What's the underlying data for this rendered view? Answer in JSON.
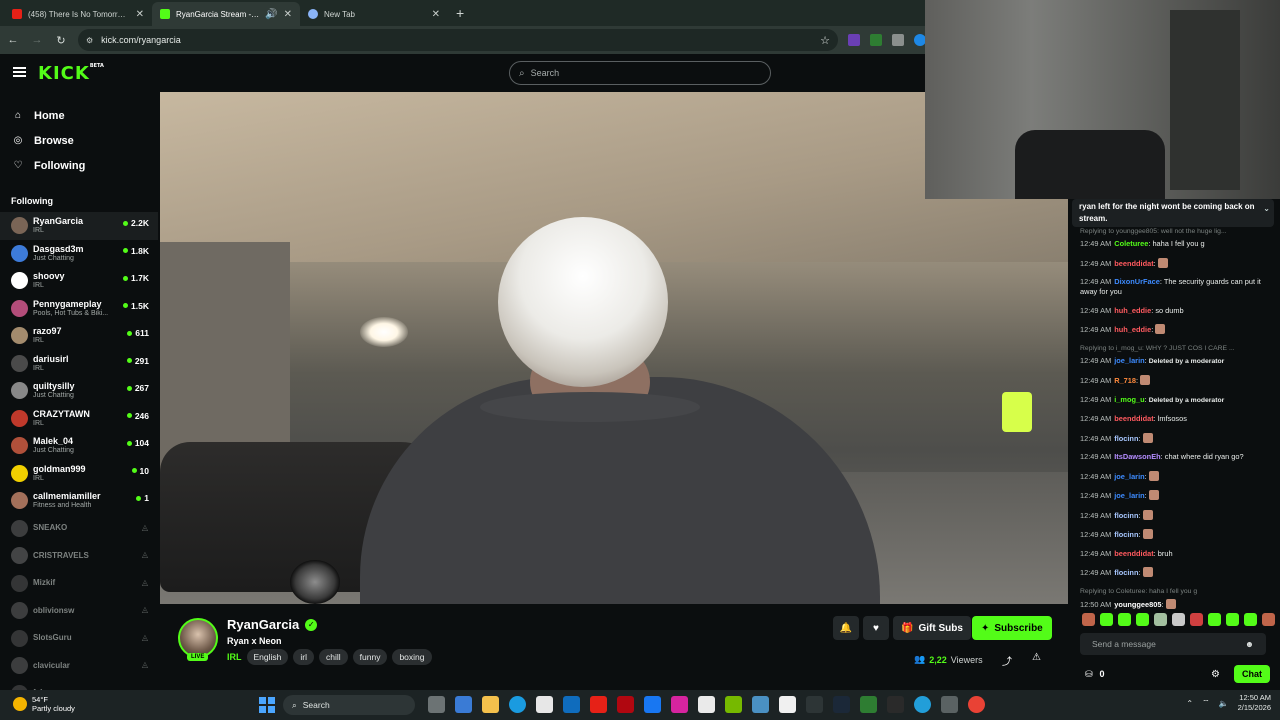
{
  "browser": {
    "tabs": [
      {
        "title": "(458) There Is No Tomorrow - Y",
        "favicon_color": "#e62117",
        "active": false
      },
      {
        "title": "RyanGarcia Stream - Watch",
        "favicon_color": "#53fc18",
        "active": true
      },
      {
        "title": "New Tab",
        "favicon_color": "#8ab4f8",
        "active": false
      }
    ],
    "url": "kick.com/ryangarcia"
  },
  "header": {
    "logo": "KICK",
    "logo_badge": "BETA",
    "search_placeholder": "Search"
  },
  "sidebar": {
    "nav": [
      {
        "label": "Home",
        "icon": "home-icon"
      },
      {
        "label": "Browse",
        "icon": "compass-icon"
      },
      {
        "label": "Following",
        "icon": "heart-icon"
      }
    ],
    "following_title": "Following",
    "channels": [
      {
        "name": "RyanGarcia",
        "category": "IRL",
        "viewers": "2.2K",
        "color": "#7a6556"
      },
      {
        "name": "Dasgasd3m",
        "category": "Just Chatting",
        "viewers": "1.8K",
        "color": "#3d7bd9"
      },
      {
        "name": "shoovy",
        "category": "IRL",
        "viewers": "1.7K",
        "color": "#ffffff"
      },
      {
        "name": "Pennygameplay",
        "category": "Pools, Hot Tubs & Biki...",
        "viewers": "1.5K",
        "color": "#b34d7a"
      },
      {
        "name": "razo97",
        "category": "IRL",
        "viewers": "611",
        "color": "#a38b6d"
      },
      {
        "name": "dariusirl",
        "category": "IRL",
        "viewers": "291",
        "color": "#4a4a4a"
      },
      {
        "name": "quiltysilly",
        "category": "Just Chatting",
        "viewers": "267",
        "color": "#888"
      },
      {
        "name": "CRAZYTAWN",
        "category": "IRL",
        "viewers": "246",
        "color": "#c0392b"
      },
      {
        "name": "Malek_04",
        "category": "Just Chatting",
        "viewers": "104",
        "color": "#b0503a"
      },
      {
        "name": "goldman999",
        "category": "IRL",
        "viewers": "10",
        "color": "#f1d000"
      },
      {
        "name": "callmemiamiller",
        "category": "Fitness and Health",
        "viewers": "1",
        "color": "#a3705a"
      }
    ],
    "offline": [
      {
        "name": "SNEAKO",
        "color": "#777"
      },
      {
        "name": "CRISTRAVELS",
        "color": "#888"
      },
      {
        "name": "Mizkif",
        "color": "#666"
      },
      {
        "name": "oblivionsw",
        "color": "#777"
      },
      {
        "name": "SlotsGuru",
        "color": "#666"
      },
      {
        "name": "clavicular",
        "color": "#777"
      },
      {
        "name": "fab...",
        "color": "#666"
      }
    ]
  },
  "stream": {
    "name": "RyanGarcia",
    "live_label": "LIVE",
    "title": "Ryan x Neon",
    "category": "IRL",
    "tags": [
      "English",
      "irl",
      "chill",
      "funny",
      "boxing"
    ],
    "gift_label": "Gift Subs",
    "subscribe_label": "Subscribe",
    "viewer_count": "2,22",
    "viewers_label": "Viewers"
  },
  "chat": {
    "pinned": "ryan left for the night wont be coming back on stream.",
    "messages": [
      {
        "reply": "Replying to younggee805: well not the huge lig..."
      },
      {
        "time": "12:49 AM",
        "user": "Coleturee",
        "color": "#53fc18",
        "text": "haha I fell you g"
      },
      {
        "time": "12:49 AM",
        "user": "beenddidat",
        "color": "#ff5a5f",
        "text": ":",
        "emote": true
      },
      {
        "time": "12:49 AM",
        "user": "DixonUrFace",
        "color": "#3d8bff",
        "text": "The security guards can put it away for you"
      },
      {
        "time": "12:49 AM",
        "user": "huh_eddie",
        "color": "#ff5a5f",
        "text": "so dumb"
      },
      {
        "time": "12:49 AM",
        "user": "huh_eddie",
        "color": "#ff5a5f",
        "text": ":",
        "emote": true
      },
      {
        "reply": "Replying to i_mog_u: WHY ? JUST COS I CARE ..."
      },
      {
        "time": "12:49 AM",
        "user": "joe_larin",
        "color": "#3d8bff",
        "text": "Deleted by a moderator",
        "mod": true
      },
      {
        "time": "12:49 AM",
        "user": "R_718",
        "color": "#ff8a3d",
        "text": ":",
        "emote": true
      },
      {
        "time": "12:49 AM",
        "user": "i_mog_u",
        "color": "#53fc18",
        "text": "Deleted by a moderator",
        "mod": true
      },
      {
        "time": "12:49 AM",
        "user": "beenddidat",
        "color": "#ff5a5f",
        "text": "lmfsosos"
      },
      {
        "time": "12:49 AM",
        "user": "flocinn",
        "color": "#a8c7ff",
        "text": ":",
        "emote": true
      },
      {
        "time": "12:49 AM",
        "user": "ItsDawsonEh",
        "color": "#b48cff",
        "text": "chat where did ryan go?"
      },
      {
        "time": "12:49 AM",
        "user": "joe_larin",
        "color": "#3d8bff",
        "text": ":",
        "emote": true
      },
      {
        "time": "12:49 AM",
        "user": "joe_larin",
        "color": "#3d8bff",
        "text": ":",
        "emote": true
      },
      {
        "time": "12:49 AM",
        "user": "flocinn",
        "color": "#a8c7ff",
        "text": ":",
        "emote": true
      },
      {
        "time": "12:49 AM",
        "user": "flocinn",
        "color": "#a8c7ff",
        "text": ":",
        "emote": true
      },
      {
        "time": "12:49 AM",
        "user": "beenddidat",
        "color": "#ff5a5f",
        "text": "bruh"
      },
      {
        "time": "12:49 AM",
        "user": "flocinn",
        "color": "#a8c7ff",
        "text": ":",
        "emote": true
      },
      {
        "reply": "Replying to Coleturee: haha I fell you g"
      },
      {
        "time": "12:50 AM",
        "user": "younggee805",
        "color": "#ffffff",
        "text": ":",
        "emote": true
      }
    ],
    "input_placeholder": "Send a message",
    "points": "0",
    "chat_button": "Chat"
  },
  "taskbar": {
    "temp": "54°F",
    "weather": "Partly cloudy",
    "search_label": "Search",
    "time": "12:50 AM",
    "date": "2/15/2026"
  }
}
